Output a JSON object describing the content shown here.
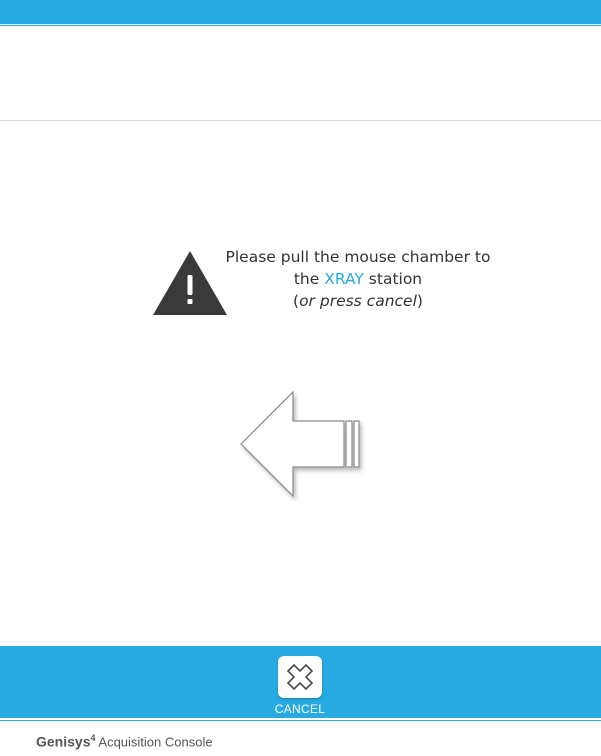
{
  "theme": {
    "accent": "#27aae2",
    "warning_icon_color": "#3a3a3a"
  },
  "message": {
    "line1": "Please pull the mouse chamber to",
    "line2_prefix": "the ",
    "line2_highlight": "XRAY",
    "line2_suffix": " station",
    "line3_open": "(",
    "line3_italic": "or press cancel",
    "line3_close": ")"
  },
  "icons": {
    "warning": "warning-triangle-icon",
    "direction": "left-arrow-icon",
    "cancel": "x-cancel-icon"
  },
  "cancel_button": {
    "label": "CANCEL"
  },
  "footer": {
    "brand": "Genisys",
    "superscript": "4",
    "subtitle": " Acquisition Console"
  }
}
